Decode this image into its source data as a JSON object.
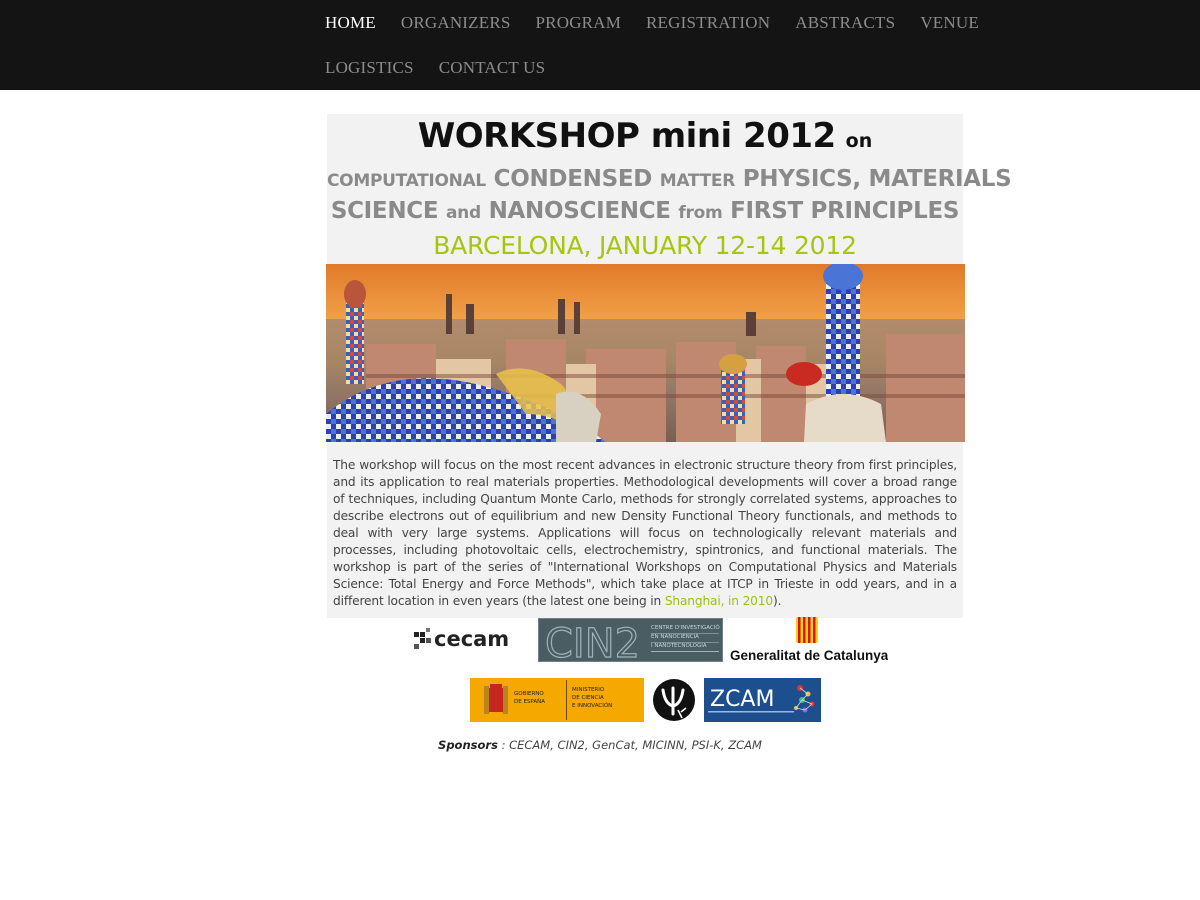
{
  "nav": {
    "items": [
      {
        "label": "HOME",
        "active": true
      },
      {
        "label": "ORGANIZERS"
      },
      {
        "label": "PROGRAM"
      },
      {
        "label": "REGISTRATION"
      },
      {
        "label": "ABSTRACTS"
      },
      {
        "label": "VENUE"
      },
      {
        "label": "LOGISTICS"
      },
      {
        "label": "CONTACT US"
      }
    ]
  },
  "banner": {
    "workshop": "WORKSHOP mini 2012",
    "on": "on",
    "w_computational": "COMPUTATIONAL",
    "w_condensed": "CONDENSED",
    "w_matter": "MATTER",
    "w_physics": "PHYSICS, MATERIALS",
    "w_science": "SCIENCE",
    "w_and": "and",
    "w_nanoscience": "NANOSCIENCE",
    "w_from": "from",
    "w_first": "FIRST PRINCIPLES",
    "location": "BARCELONA, JANUARY 12-14 2012"
  },
  "description": {
    "text": "The workshop will focus on the most recent advances in electronic structure theory from first principles, and its application to real materials properties. Methodological developments will cover a broad range of techniques, including Quantum Monte Carlo, methods for strongly correlated systems, approaches to describe electrons out of equilibrium and new Density Functional Theory functionals, and methods to deal with very large systems. Applications will focus on technologically relevant materials and processes, including photovoltaic cells, electrochemistry, spintronics, and functional materials. The workshop is part of the series of \"International Workshops on Computational Physics and Materials Science: Total Energy and Force Methods\", which take place at ITCP in Trieste in odd years, and in a different location in even years (the latest one being in ",
    "link": "Shanghai, in 2010",
    "tail": ")."
  },
  "logos": {
    "cecam": "cecam",
    "cin2": "CIN2",
    "cin2_sub1": "CENTRE D'INVESTIGACIÓ",
    "cin2_sub2": "EN NANOCIÈNCIA",
    "cin2_sub3": "I NANOTECNOLOGIA",
    "gencat": "Generalitat de Catalunya",
    "gobierno1": "GOBIERNO",
    "gobierno2": "DE ESPAÑA",
    "ministerio1": "MINISTERIO",
    "ministerio2": "DE CIENCIA",
    "ministerio3": "E INNOVACIÓN",
    "zcam": "ZCAM"
  },
  "sponsors": {
    "label": "Sponsors",
    "list": "CECAM, CIN2, GenCat, MICINN, PSI-K, ZCAM"
  },
  "colors": {
    "nav_bg": "#141414",
    "nav_text": "#8c8c8c",
    "nav_active": "#ffffff",
    "accent_green": "#a6c512",
    "panel_bg": "#f2f2f2"
  }
}
